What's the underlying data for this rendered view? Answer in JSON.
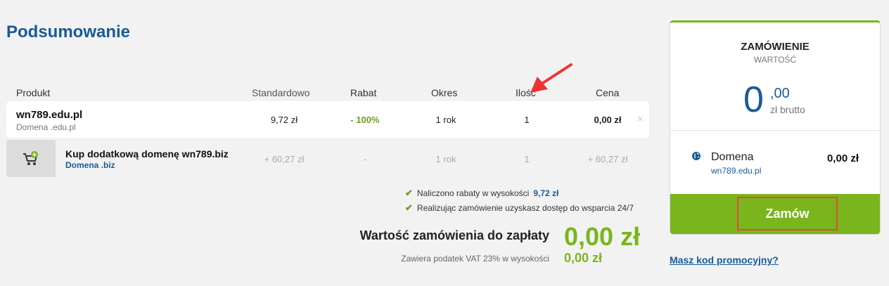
{
  "page": {
    "title": "Podsumowanie"
  },
  "table": {
    "headers": {
      "product": "Produkt",
      "standard": "Standardowo",
      "discount": "Rabat",
      "period": "Okres",
      "quantity": "Ilość",
      "price": "Cena"
    },
    "rows": [
      {
        "name": "wn789.edu.pl",
        "sub": "Domena .edu.pl",
        "standard": "9,72 zł",
        "discount": "- 100%",
        "period": "1 rok",
        "quantity": "1",
        "price": "0,00 zł",
        "remove": "×"
      }
    ],
    "upsell": {
      "name": "Kup dodatkową domenę wn789.biz",
      "sub": "Domena .biz",
      "standard": "+ 60,27 zł",
      "discount": "-",
      "period": "1 rok",
      "quantity": "1",
      "price": "+ 60,27 zł"
    }
  },
  "notes": [
    {
      "text": "Naliczono rabaty w wysokości",
      "value": "9,72 zł"
    },
    {
      "text": "Realizując zamówienie uzyskasz dostęp do wsparcia 24/7",
      "value": ""
    }
  ],
  "total": {
    "label": "Wartość zamówienia do zapłaty",
    "value": "0,00 zł",
    "vat_label": "Zawiera podatek VAT 23% w wysokości",
    "vat_value": "0,00 zł"
  },
  "order_card": {
    "title": "ZAMÓWIENIE",
    "subtitle": "WARTOŚĆ",
    "amount_int": "0",
    "amount_cents": ",00",
    "amount_unit": "zł brutto",
    "item": {
      "name": "Domena",
      "sub": "wn789.edu.pl",
      "price": "0,00 zł"
    },
    "button": "Zamów"
  },
  "promo_link": "Masz kod promocyjny?",
  "colors": {
    "accent_green": "#7ab51d",
    "brand_blue": "#1a5b96",
    "highlight_red": "#e14a3b"
  }
}
